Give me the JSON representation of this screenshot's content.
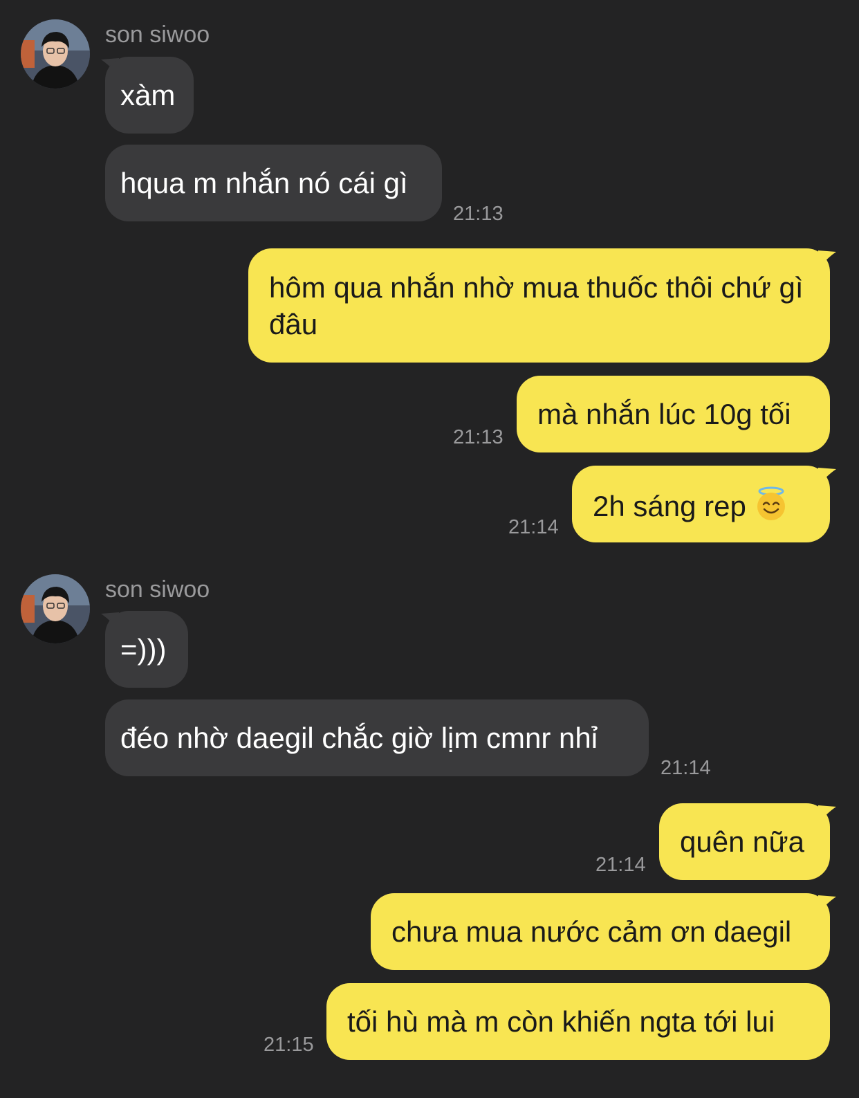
{
  "colors": {
    "background": "#232324",
    "incoming_bubble": "#3a3a3c",
    "outgoing_bubble": "#f8e552",
    "timestamp": "#9a9a9c"
  },
  "contact": {
    "name": "son siwoo",
    "avatar_icon": "user-avatar-photo"
  },
  "messages": [
    {
      "sender": "son siwoo",
      "text": "xàm"
    },
    {
      "sender": "son siwoo",
      "text": "hqua m nhắn nó cái gì",
      "time": "21:13"
    },
    {
      "sender": "me",
      "text": "hôm qua nhắn nhờ mua thuốc thôi chứ gì đâu"
    },
    {
      "sender": "me",
      "text": "mà nhắn lúc 10g tối",
      "time": "21:13"
    },
    {
      "sender": "me",
      "text": "2h sáng rep",
      "emoji": "smiling-face-with-halo-icon",
      "time": "21:14"
    },
    {
      "sender": "son siwoo",
      "text": "=)))"
    },
    {
      "sender": "son siwoo",
      "text": "đéo nhờ daegil chắc giờ lịm cmnr nhỉ",
      "time": "21:14"
    },
    {
      "sender": "me",
      "text": "quên nữa",
      "time": "21:14"
    },
    {
      "sender": "me",
      "text": "chưa mua nước cảm ơn daegil"
    },
    {
      "sender": "me",
      "text": "tối hù mà m còn khiến ngta tới lui",
      "time": "21:15"
    }
  ]
}
